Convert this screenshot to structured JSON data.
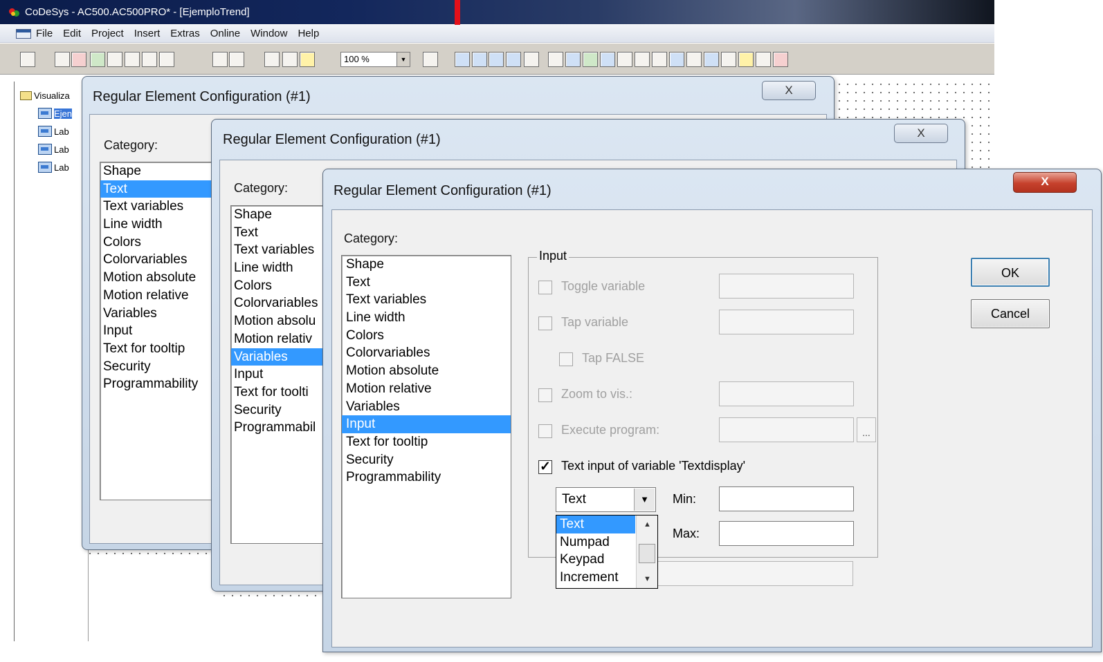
{
  "window": {
    "title": "CoDeSys - AC500.AC500PRO* - [EjemploTrend]"
  },
  "menu": [
    "File",
    "Edit",
    "Project",
    "Insert",
    "Extras",
    "Online",
    "Window",
    "Help"
  ],
  "toolbar": {
    "zoom": "100 %"
  },
  "tree": {
    "root": "Visualiza",
    "items": [
      "Ejen",
      "Lab",
      "Lab",
      "Lab"
    ]
  },
  "dialog1": {
    "title": "Regular Element Configuration (#1)",
    "close": "X",
    "category_label": "Category:",
    "categories": [
      "Shape",
      "Text",
      "Text variables",
      "Line width",
      "Colors",
      "Colorvariables",
      "Motion absolute",
      "Motion relative",
      "Variables",
      "Input",
      "Text for tooltip",
      "Security",
      "Programmability"
    ],
    "selected": "Text"
  },
  "dialog2": {
    "title": "Regular Element Configuration (#1)",
    "close": "X",
    "category_label": "Category:",
    "categories": [
      "Shape",
      "Text",
      "Text variables",
      "Line width",
      "Colors",
      "Colorvariables",
      "Motion absolu",
      "Motion relativ",
      "Variables",
      "Input",
      "Text for toolti",
      "Security",
      "Programmabil"
    ],
    "selected": "Variables"
  },
  "dialog3": {
    "title": "Regular Element Configuration (#1)",
    "close": "X",
    "category_label": "Category:",
    "categories": [
      "Shape",
      "Text",
      "Text variables",
      "Line width",
      "Colors",
      "Colorvariables",
      "Motion absolute",
      "Motion relative",
      "Variables",
      "Input",
      "Text for tooltip",
      "Security",
      "Programmability"
    ],
    "selected": "Input",
    "ok": "OK",
    "cancel": "Cancel",
    "input_group": {
      "legend": "Input",
      "toggle_variable": "Toggle variable",
      "tap_variable": "Tap variable",
      "tap_false": "Tap FALSE",
      "zoom_to_vis": "Zoom to vis.:",
      "execute_program": "Execute program:",
      "ellipsis": "...",
      "text_input": "Text input of variable 'Textdisplay'",
      "text_input_checked": true,
      "combo_value": "Text",
      "min_label": "Min:",
      "max_label": "Max:",
      "combo_options": [
        "Text",
        "Numpad",
        "Keypad",
        "Increment"
      ]
    }
  }
}
